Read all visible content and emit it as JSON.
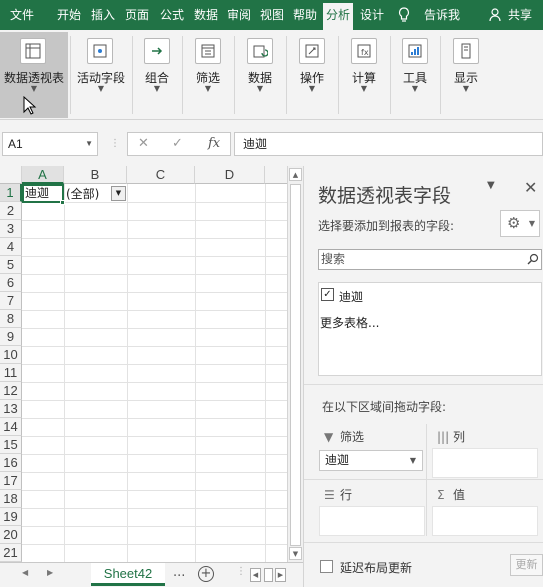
{
  "menubar": {
    "tabs": [
      "文件",
      "开始",
      "插入",
      "页面",
      "公式",
      "数据",
      "审阅",
      "视图",
      "帮助",
      "分析",
      "设计"
    ],
    "active_tab": "分析",
    "tell_me": "告诉我",
    "share": "共享"
  },
  "ribbon": {
    "buttons": [
      {
        "label": "数据透视表",
        "icon": "pivot-table-icon",
        "has_dropdown": true
      },
      {
        "label": "活动字段",
        "icon": "active-field-icon",
        "has_dropdown": true
      },
      {
        "label": "组合",
        "icon": "group-icon",
        "has_dropdown": true
      },
      {
        "label": "筛选",
        "icon": "filter-icon",
        "has_dropdown": true
      },
      {
        "label": "数据",
        "icon": "refresh-data-icon",
        "has_dropdown": true
      },
      {
        "label": "操作",
        "icon": "actions-icon",
        "has_dropdown": true
      },
      {
        "label": "计算",
        "icon": "calculations-icon",
        "has_dropdown": true
      },
      {
        "label": "工具",
        "icon": "tools-icon",
        "has_dropdown": true
      },
      {
        "label": "显示",
        "icon": "show-icon",
        "has_dropdown": true
      }
    ]
  },
  "formula_bar": {
    "name_box": "A1",
    "fx": "fx",
    "cancel": "✕",
    "enter": "✓",
    "content": "迪迦"
  },
  "grid": {
    "columns": [
      "A",
      "B",
      "C",
      "D"
    ],
    "selected_column": "A",
    "rows": [
      "1",
      "2",
      "3",
      "4",
      "5",
      "6",
      "7",
      "8",
      "9",
      "10",
      "11",
      "12",
      "13",
      "14",
      "15",
      "16",
      "17",
      "18",
      "19",
      "20",
      "21"
    ],
    "selected_row": "1",
    "cell_a1": "迪迦",
    "cell_b1": "(全部)"
  },
  "sheet_tabs": {
    "active": "Sheet42",
    "more": "...",
    "add": "+"
  },
  "pivot_panel": {
    "title": "数据透视表字段",
    "subtitle": "选择要添加到报表的字段:",
    "search_placeholder": "搜索",
    "fields": [
      {
        "name": "迪迦",
        "checked": true
      }
    ],
    "more_tables": "更多表格...",
    "drag_tip": "在以下区域间拖动字段:",
    "zones": {
      "filter_label": "筛选",
      "columns_label": "列",
      "rows_label": "行",
      "values_label": "值",
      "filter_field": "迪迦"
    },
    "defer_label": "延迟布局更新",
    "update_button": "更新"
  }
}
